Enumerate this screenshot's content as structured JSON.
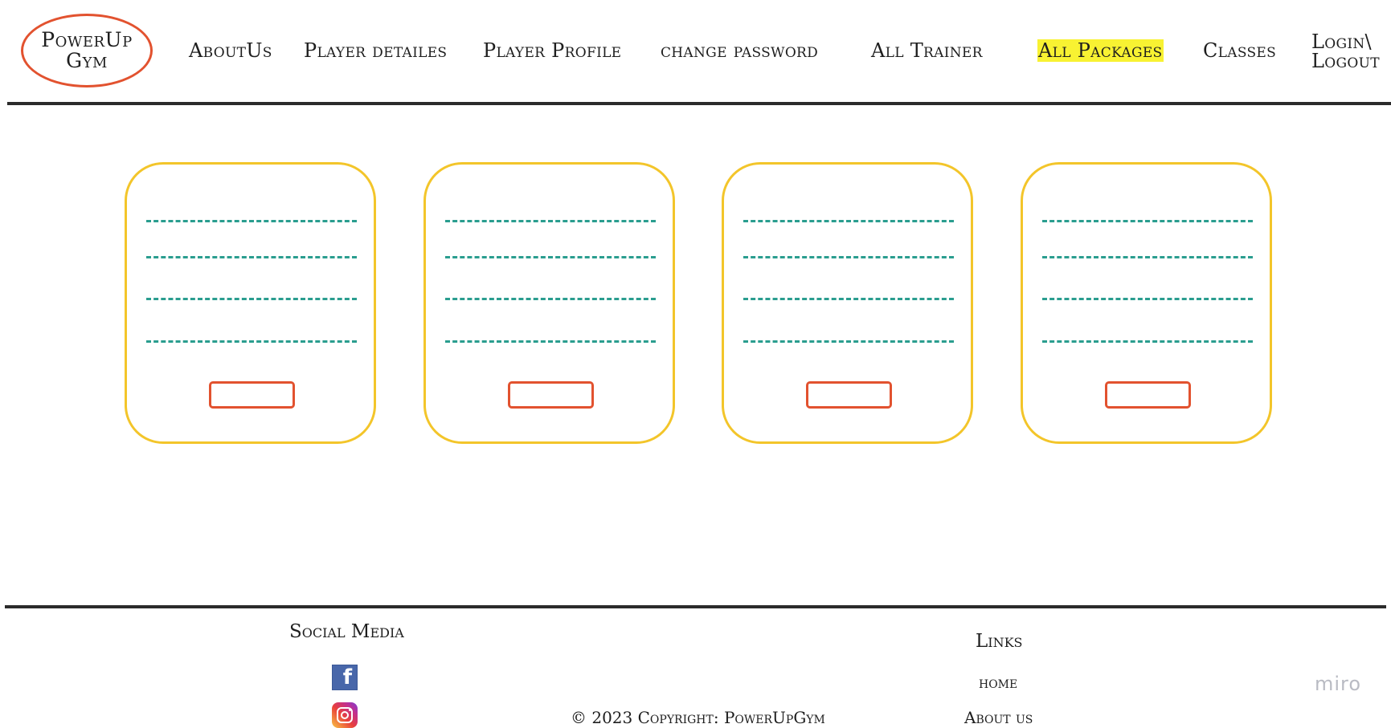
{
  "header": {
    "logo_line1": "PowerUp",
    "logo_line2": "Gym",
    "nav": {
      "about": "AboutUs",
      "player_details": "Player detailes",
      "player_profile": "Player Profile",
      "change_password": "change password",
      "all_trainer": "All Trainer",
      "all_packages": "All Packages",
      "classes": "Classes",
      "login_line1": "Login\\",
      "login_line2": "Logout"
    },
    "active_item": "All Packages",
    "highlight_color": "#f8f232"
  },
  "packages": {
    "card_count": 4,
    "placeholder_lines_per_card": 4,
    "card_border_color": "#f3c52a",
    "line_color": "#2a9d8f",
    "button_border_color": "#e2522f"
  },
  "footer": {
    "social_title": "Social Media",
    "social_icons": [
      "facebook-icon",
      "instagram-icon"
    ],
    "copyright": "© 2023 Copyright: PowerUpGym",
    "links_title": "Links",
    "links": [
      "home",
      "About us"
    ]
  },
  "watermark": "miro"
}
